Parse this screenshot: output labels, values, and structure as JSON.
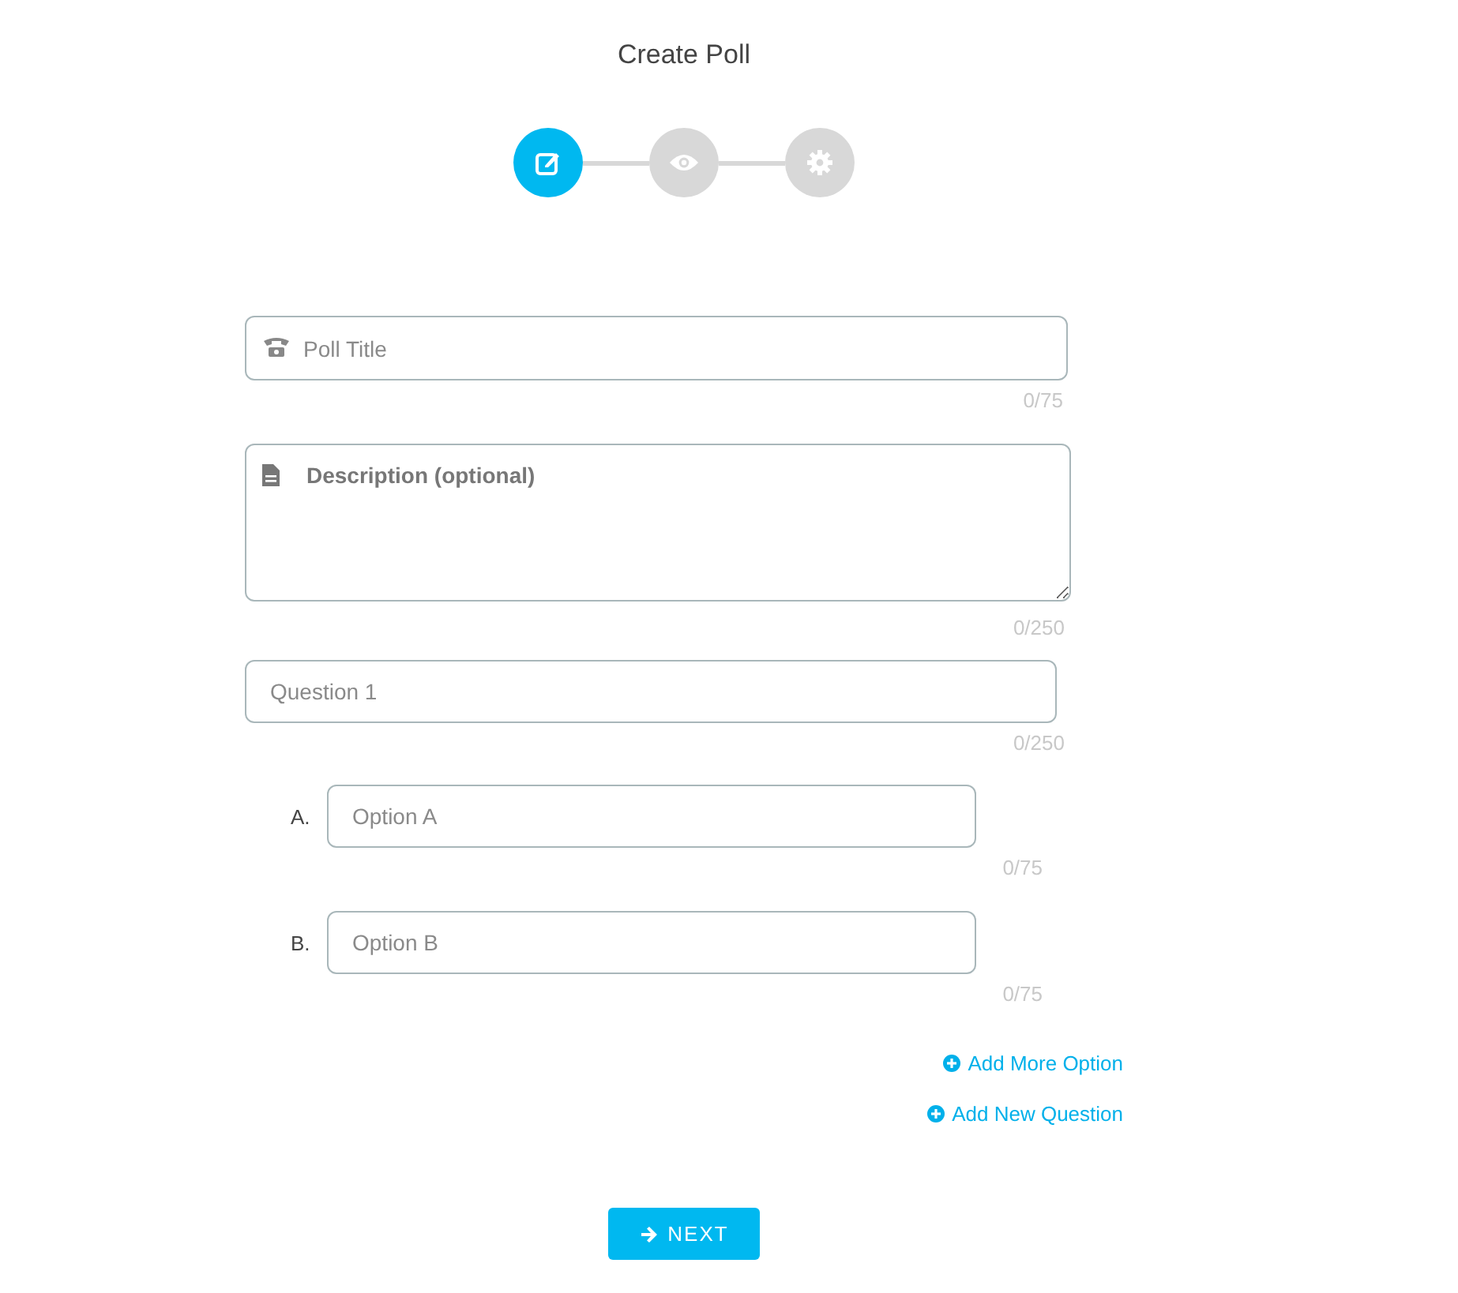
{
  "title": "Create Poll",
  "steps": [
    {
      "kind": "edit",
      "selected": true
    },
    {
      "kind": "preview",
      "selected": false
    },
    {
      "kind": "settings",
      "selected": false
    }
  ],
  "poll_title": {
    "placeholder": "Poll Title",
    "counter": "0/75"
  },
  "description": {
    "placeholder": "Description (optional)",
    "counter": "0/250"
  },
  "question": {
    "placeholder": "Question 1",
    "counter": "0/250"
  },
  "options": [
    {
      "label": "A.",
      "placeholder": "Option A",
      "counter": "0/75"
    },
    {
      "label": "B.",
      "placeholder": "Option B",
      "counter": "0/75"
    }
  ],
  "links": [
    "Add More Option",
    "Add New Question"
  ],
  "next_button": "NEXT"
}
